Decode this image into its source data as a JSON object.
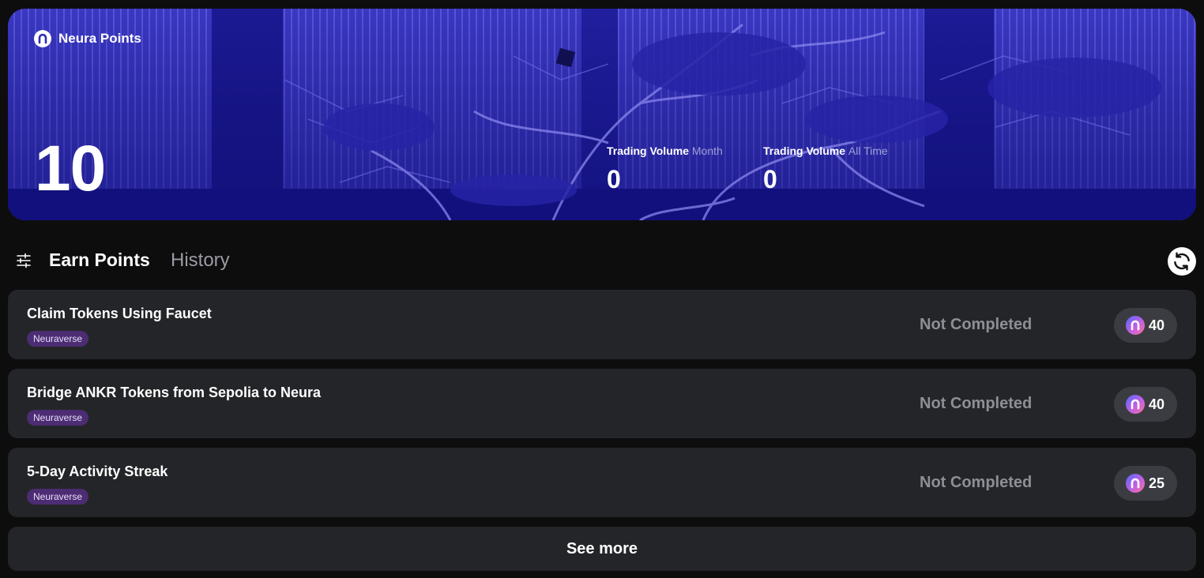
{
  "hero": {
    "brand_icon": "neura-logo-icon",
    "brand_name": "Neura Points",
    "points": "10",
    "volumes": [
      {
        "label": "Trading Volume",
        "period": "Month",
        "value": "0"
      },
      {
        "label": "Trading Volume",
        "period": "All Time",
        "value": "0"
      }
    ]
  },
  "tabs": {
    "filter_icon": "sliders-icon",
    "items": [
      {
        "label": "Earn Points",
        "active": true
      },
      {
        "label": "History",
        "active": false
      }
    ],
    "refresh_icon": "refresh-icon"
  },
  "tasks": [
    {
      "title": "Claim Tokens Using Faucet",
      "tag": "Neuraverse",
      "status": "Not Completed",
      "reward": "40",
      "reward_icon": "neura-coin-icon"
    },
    {
      "title": "Bridge ANKR Tokens from Sepolia to Neura",
      "tag": "Neuraverse",
      "status": "Not Completed",
      "reward": "40",
      "reward_icon": "neura-coin-icon"
    },
    {
      "title": "5-Day Activity Streak",
      "tag": "Neuraverse",
      "status": "Not Completed",
      "reward": "25",
      "reward_icon": "neura-coin-icon"
    }
  ],
  "see_more": "See more",
  "colors": {
    "hero_blue": "#3431b8",
    "card_bg": "#242528",
    "tag_bg": "#4c2c72",
    "status_gray": "#8e8f96"
  }
}
